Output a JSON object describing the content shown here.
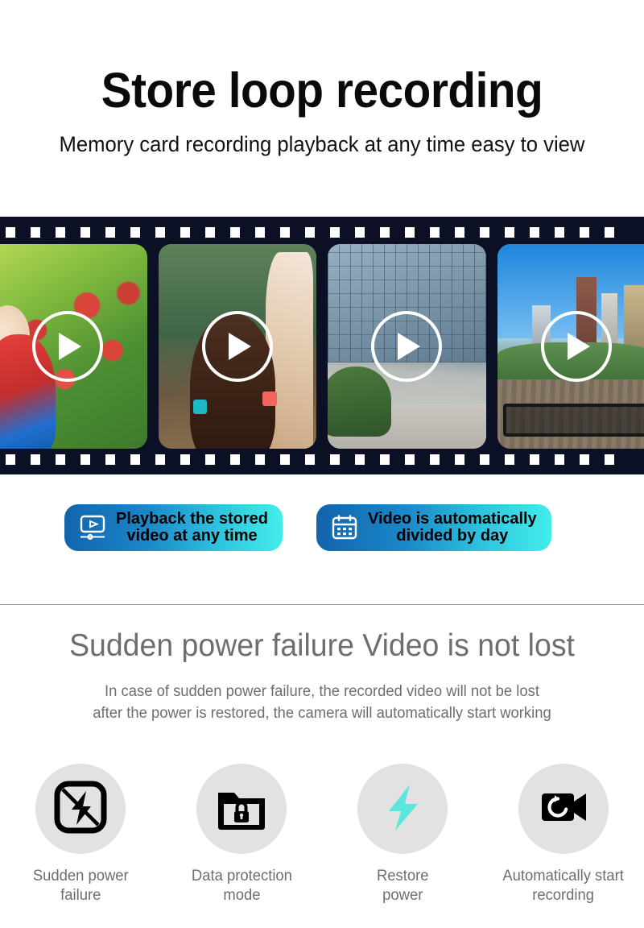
{
  "hero": {
    "title": "Store loop recording",
    "subtitle": "Memory card recording  playback at any time  easy to view"
  },
  "filmstrip": {
    "frames": [
      {
        "alt": "child picking apples in orchard",
        "play_icon": "play-icon"
      },
      {
        "alt": "children raising hands in classroom",
        "play_icon": "play-icon"
      },
      {
        "alt": "glass office building plaza",
        "play_icon": "play-icon"
      },
      {
        "alt": "city skyline park boardwalk",
        "play_icon": "play-icon"
      }
    ],
    "sprocket_count": 25,
    "background_color": "#0b1024"
  },
  "badges": [
    {
      "icon": "monitor-play-icon",
      "text": "Playback the stored\nvideo at any time",
      "gradient_start": "#1264ab",
      "gradient_end": "#43edea"
    },
    {
      "icon": "calendar-icon",
      "text": "Video is automatically\ndivided by day",
      "gradient_start": "#1264ab",
      "gradient_end": "#43edea"
    }
  ],
  "lower": {
    "title": "Sudden power failure   Video is not lost",
    "description": "In case of sudden power failure, the recorded video will not be lost\nafter the power is restored, the camera will automatically start working",
    "text_color": "#6e6e6e"
  },
  "features": [
    {
      "icon": "no-power-icon",
      "label": "Sudden power\nfailure",
      "circle_color": "#e2e2e2",
      "icon_color": "#000000"
    },
    {
      "icon": "folder-lock-icon",
      "label": "Data protection\nmode",
      "circle_color": "#e2e2e2",
      "icon_color": "#000000"
    },
    {
      "icon": "lightning-bolt-icon",
      "label": "Restore\npower",
      "circle_color": "#e2e2e2",
      "icon_color": "#5be5dc"
    },
    {
      "icon": "camera-restart-icon",
      "label": "Automatically start\nrecording",
      "circle_color": "#e2e2e2",
      "icon_color": "#000000"
    }
  ]
}
